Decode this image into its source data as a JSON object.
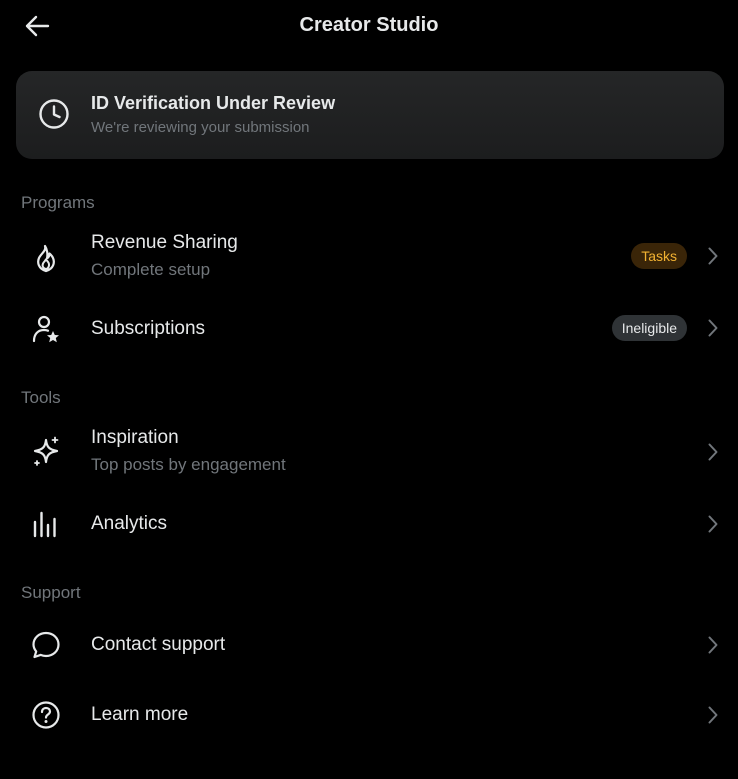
{
  "header": {
    "title": "Creator Studio",
    "back_icon": "arrow-left-icon"
  },
  "status_card": {
    "icon": "clock-icon",
    "title": "ID Verification Under Review",
    "subtitle": "We're reviewing your submission"
  },
  "sections": {
    "programs": {
      "label": "Programs",
      "items": [
        {
          "icon": "flame-icon",
          "title": "Revenue Sharing",
          "subtitle": "Complete setup",
          "badge": "Tasks"
        },
        {
          "icon": "person-star-icon",
          "title": "Subscriptions",
          "badge": "Ineligible"
        }
      ]
    },
    "tools": {
      "label": "Tools",
      "items": [
        {
          "icon": "sparkle-icon",
          "title": "Inspiration",
          "subtitle": "Top posts by engagement"
        },
        {
          "icon": "bar-chart-icon",
          "title": "Analytics"
        }
      ]
    },
    "support": {
      "label": "Support",
      "items": [
        {
          "icon": "chat-bubble-icon",
          "title": "Contact support"
        },
        {
          "icon": "question-circle-icon",
          "title": "Learn more"
        }
      ]
    }
  },
  "colors": {
    "background": "#000000",
    "card_background": "#202122",
    "primary_text": "#e7e9ea",
    "secondary_text": "#71767b",
    "tasks_badge_bg": "#3a2508",
    "tasks_badge_text": "#f2b232",
    "ineligible_badge_bg": "#2f3336"
  }
}
